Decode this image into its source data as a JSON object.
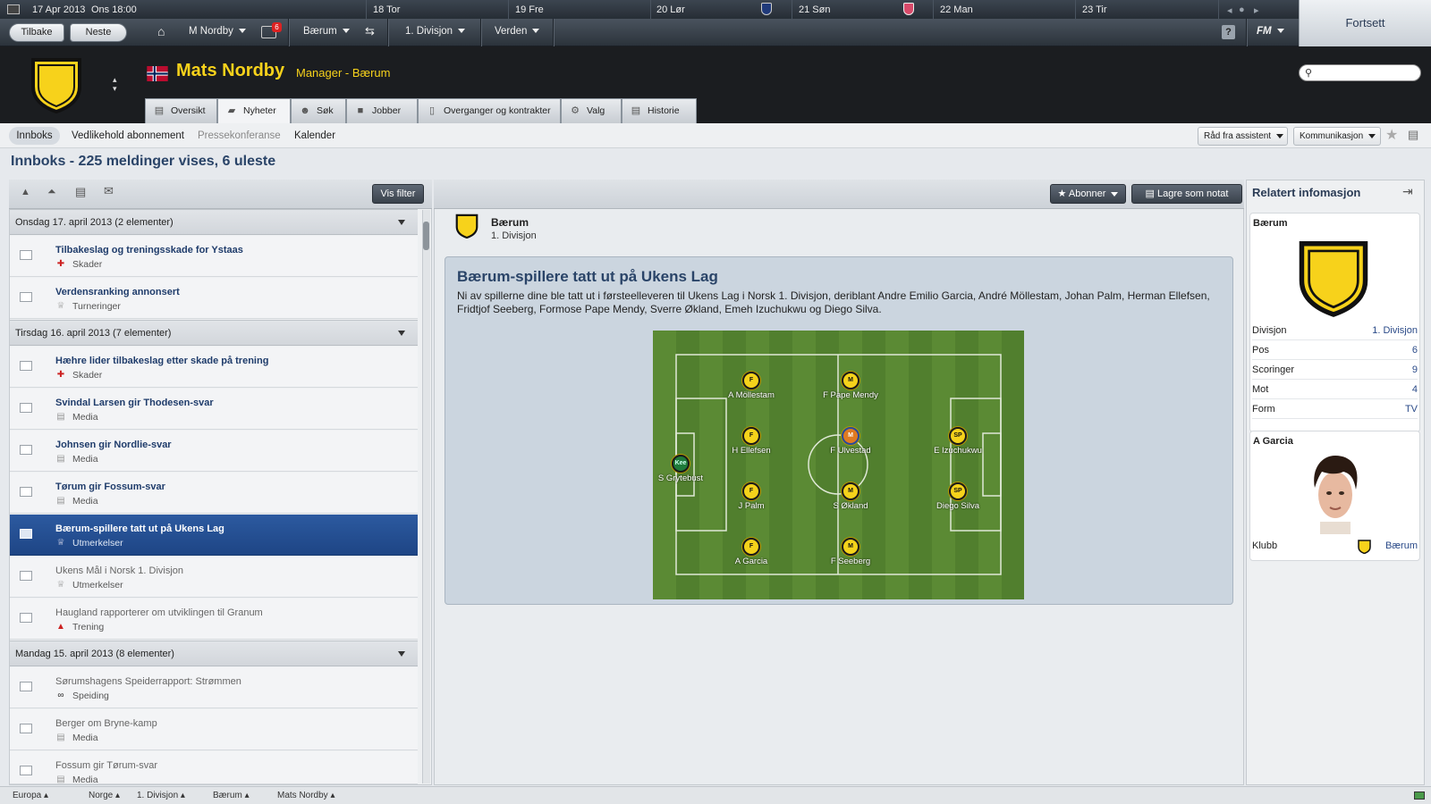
{
  "calendar": {
    "current_date": "17 Apr 2013",
    "current_day_time": "Ons  18:00",
    "days": [
      "18 Tor",
      "19 Fre",
      "20 Lør",
      "21 Søn",
      "22 Man",
      "23 Tir"
    ]
  },
  "nav": {
    "back": "Tilbake",
    "next": "Neste",
    "manager": "M Nordby",
    "badge_count": "6",
    "club": "Bærum",
    "league": "1. Divisjon",
    "world": "Verden",
    "help": "?",
    "fm": "FM",
    "continue": "Fortsett"
  },
  "header": {
    "name": "Mats Nordby",
    "role": "Manager - Bærum",
    "tabs": [
      "Oversikt",
      "Nyheter",
      "Søk",
      "Jobber",
      "Overganger og kontrakter",
      "Valg",
      "Historie"
    ]
  },
  "subnav": {
    "items": [
      "Innboks",
      "Vedlikehold abonnement",
      "Pressekonferanse",
      "Kalender"
    ],
    "assistant": "Råd fra assistent",
    "communication": "Kommunikasjon"
  },
  "page_title": "Innboks - 225 meldinger vises, 6 uleste",
  "inbox": {
    "filter_button": "Vis filter",
    "groups": [
      {
        "label": "Onsdag 17. april 2013 (2 elementer)"
      },
      {
        "label": "Tirsdag 16. april 2013 (7 elementer)"
      },
      {
        "label": "Mandag 15. april 2013 (8 elementer)"
      }
    ],
    "messages": [
      {
        "subject": "Tilbakeslag og treningsskade for Ystaas",
        "category": "Skader"
      },
      {
        "subject": "Verdensranking annonsert",
        "category": "Turneringer"
      },
      {
        "subject": "Hæhre lider tilbakeslag etter skade på trening",
        "category": "Skader"
      },
      {
        "subject": "Svindal Larsen gir Thodesen-svar",
        "category": "Media"
      },
      {
        "subject": "Johnsen gir Nordlie-svar",
        "category": "Media"
      },
      {
        "subject": "Tørum gir Fossum-svar",
        "category": "Media"
      },
      {
        "subject": "Bærum-spillere tatt ut på Ukens Lag",
        "category": "Utmerkelser"
      },
      {
        "subject": "Ukens Mål i Norsk 1. Divisjon",
        "category": "Utmerkelser"
      },
      {
        "subject": "Haugland rapporterer om utviklingen til Granum",
        "category": "Trening"
      },
      {
        "subject": "Sørumshagens Speiderrapport: Strømmen",
        "category": "Speiding"
      },
      {
        "subject": "Berger om Bryne-kamp",
        "category": "Media"
      },
      {
        "subject": "Fossum gir Tørum-svar",
        "category": "Media"
      }
    ]
  },
  "article": {
    "subscribe": "Abonner",
    "save_note": "Lagre som notat",
    "source_club": "Bærum",
    "source_league": "1. Divisjon",
    "title": "Bærum-spillere tatt ut på Ukens Lag",
    "body": "Ni av spillerne dine ble tatt ut i førsteelleveren til Ukens Lag i Norsk 1. Divisjon, deriblant Andre Emilio Garcia, André Möllestam, Johan Palm, Herman Ellefsen, Fridtjof Seeberg, Formose Pape Mendy, Sverre Økland, Emeh Izuchukwu og Diego Silva.",
    "players": [
      {
        "name": "S Grytebust",
        "pos": "Kee"
      },
      {
        "name": "A Möllestam",
        "pos": "F"
      },
      {
        "name": "H Ellefsen",
        "pos": "F"
      },
      {
        "name": "J Palm",
        "pos": "F"
      },
      {
        "name": "A Garcia",
        "pos": "F"
      },
      {
        "name": "F Pape Mendy",
        "pos": "M"
      },
      {
        "name": "F Ulvestad",
        "pos": "M"
      },
      {
        "name": "S Økland",
        "pos": "M"
      },
      {
        "name": "F Seeberg",
        "pos": "M"
      },
      {
        "name": "E Izuchukwu",
        "pos": "SP"
      },
      {
        "name": "Diego Silva",
        "pos": "SP"
      }
    ]
  },
  "related": {
    "title": "Relatert infomasjon",
    "club_card_title": "Bærum",
    "stats": [
      {
        "k": "Divisjon",
        "v": "1. Divisjon"
      },
      {
        "k": "Pos",
        "v": "6"
      },
      {
        "k": "Scoringer",
        "v": "9"
      },
      {
        "k": "Mot",
        "v": "4"
      },
      {
        "k": "Form",
        "v": "TV"
      }
    ],
    "player_card_title": "A Garcia",
    "club_label": "Klubb",
    "club_value": "Bærum"
  },
  "bottom": [
    "Europa",
    "Norge",
    "1. Divisjon",
    "Bærum",
    "Mats Nordby"
  ],
  "colors": {
    "accent_yellow": "#f7d21b",
    "selected_blue": "#2c5aa0",
    "title_blue": "#2a4468"
  }
}
